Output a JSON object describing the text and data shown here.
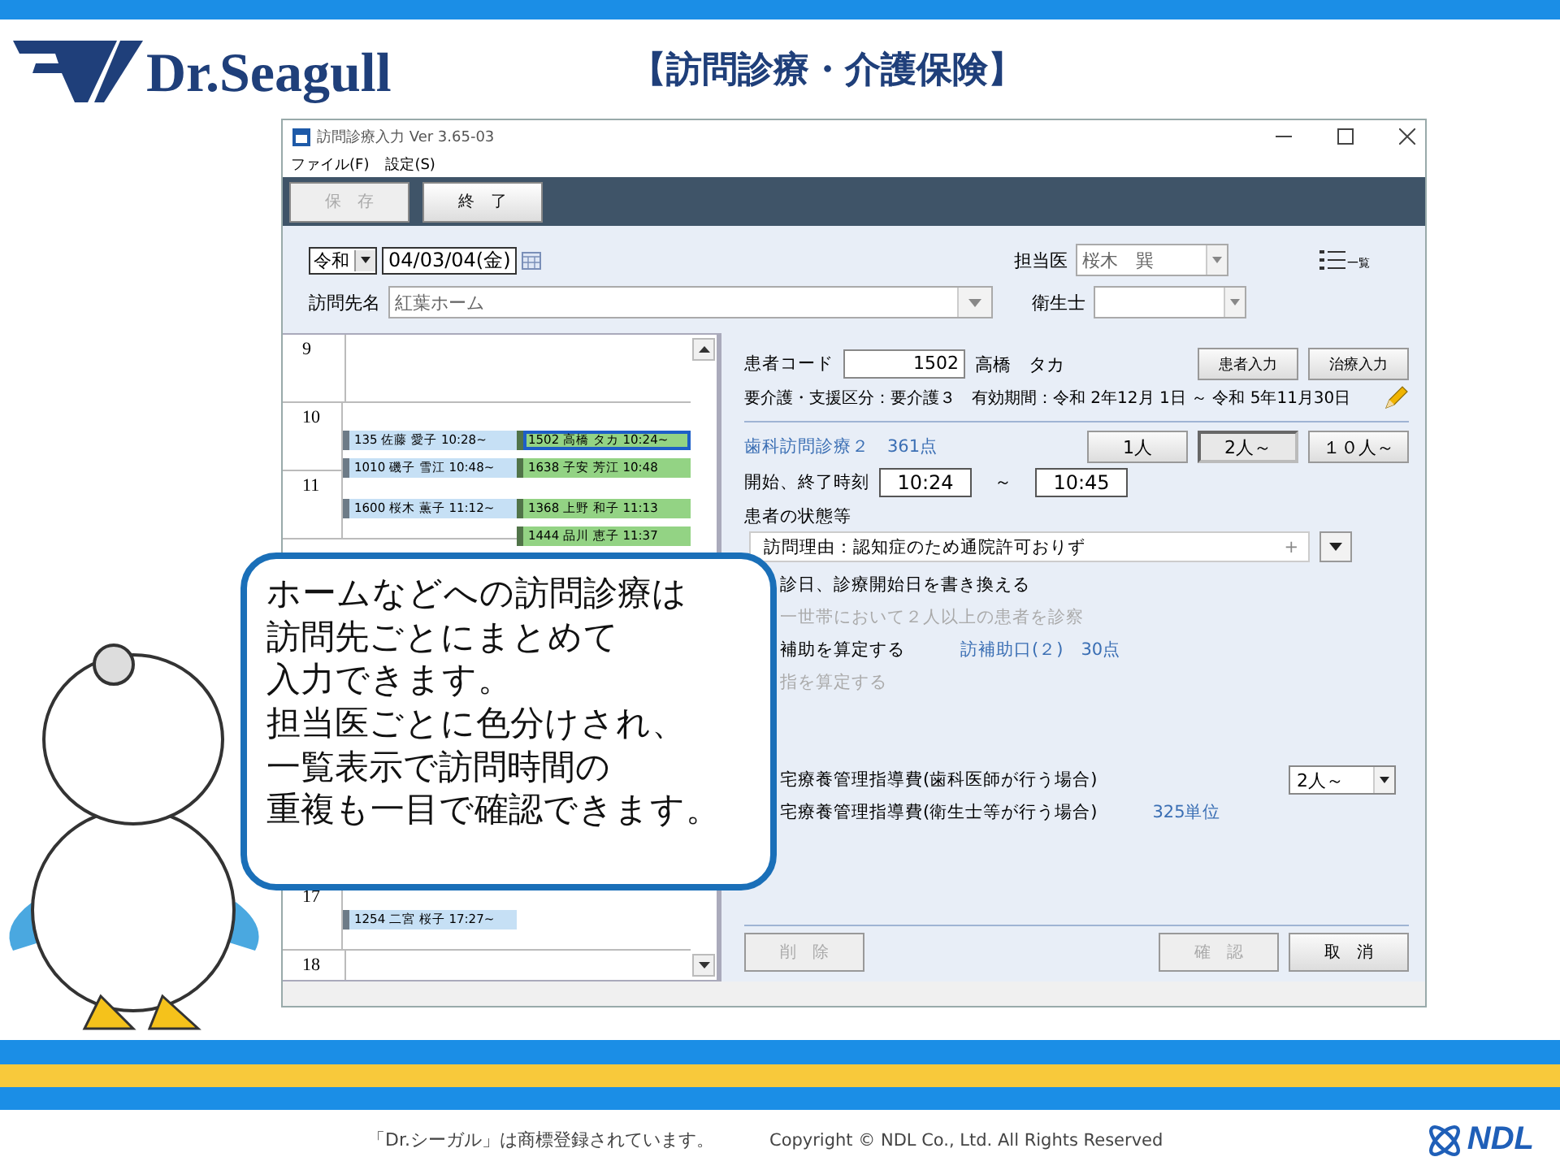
{
  "slide": {
    "logo": "Dr.Seagull",
    "title": "【訪問診療・介護保険】"
  },
  "window": {
    "title": "訪問診療入力 Ver 3.65-03",
    "menu": [
      "ファイル(F)",
      "設定(S)"
    ],
    "toolbar": [
      {
        "label": "保　存",
        "disabled": true
      },
      {
        "label": "終　了",
        "disabled": false
      }
    ],
    "form": {
      "era": "令和",
      "date": "04/03/04(金)",
      "place_label": "訪問先名",
      "place": "紅葉ホーム",
      "doctor_label": "担当医",
      "doctor": "桜木　巽",
      "hygienist_label": "衛生士",
      "list_button": "一覧"
    },
    "calendar": {
      "hours": [
        {
          "hour": "9"
        },
        {
          "hour": "10",
          "slots": [
            {
              "left": {
                "label": "135 佐藤 愛子 10:28~",
                "color": "#c6e0f5",
                "selected": false
              },
              "right": {
                "label": "1502 高橋 タカ 10:24~",
                "color": "#93d384",
                "selected": true
              }
            },
            {
              "left": {
                "label": "1010 磯子 雪江 10:48~",
                "color": "#c6e0f5",
                "selected": false
              },
              "right": {
                "label": "1638 子安 芳江 10:48",
                "color": "#93d384",
                "selected": false
              }
            }
          ]
        },
        {
          "hour": "11",
          "slots": [
            {
              "left": {
                "label": "1600 桜木 薫子 11:12~",
                "color": "#c6e0f5",
                "selected": false
              },
              "right": {
                "label": "1368 上野 和子 11:13",
                "color": "#93d384",
                "selected": false
              }
            },
            {
              "right": {
                "label": "1444 品川 恵子 11:37",
                "color": "#93d384",
                "selected": false
              }
            }
          ]
        },
        {
          "hour": "17",
          "slots": [
            {
              "left": {
                "label": "1254 二宮 桜子 17:27~",
                "color": "#c6e0f5",
                "selected": false
              }
            }
          ]
        },
        {
          "hour": "18"
        }
      ]
    },
    "detail": {
      "code_label": "患者コード",
      "code": "1502",
      "patient": "高橋　タカ",
      "buttons": [
        "患者入力",
        "治療入力"
      ],
      "care": "要介護・支援区分：要介護３　有効期間：令和 2年12月 1日 ～ 令和 5年11月30日",
      "visit": "歯科訪問診療２　361点",
      "people": [
        {
          "label": "1人",
          "selected": false
        },
        {
          "label": "2人～",
          "selected": true
        },
        {
          "label": "１０人～",
          "selected": false
        }
      ],
      "time_label": "開始、終了時刻",
      "start": "10:24",
      "tilde": "～",
      "end": "10:45",
      "state_label": "患者の状態等",
      "state": "訪問理由：認知症のため通院許可おりず",
      "plus": "+",
      "options": [
        {
          "text": "診日、診療開始日を書き換える",
          "disabled": false
        },
        {
          "text": "一世帯において２人以上の患者を診察",
          "disabled": true
        },
        {
          "text": "補助を算定する",
          "disabled": false,
          "note": "訪補助口(２)　30点"
        },
        {
          "text": "指を算定する",
          "disabled": true
        },
        {
          "text": "宅療養管理指導費(歯科医師が行う場合)",
          "disabled": false,
          "select": "2人～"
        },
        {
          "text": "宅療養管理指導費(衛生士等が行う場合)",
          "disabled": false,
          "note": "325単位"
        }
      ],
      "bottom_buttons": [
        {
          "label": "削　除",
          "disabled": true
        },
        {
          "label": "確　認",
          "disabled": true
        },
        {
          "label": "取　消",
          "disabled": false
        }
      ]
    }
  },
  "bubble": {
    "lines": [
      "ホームなどへの訪問診療は",
      "訪問先ごとにまとめて",
      "入力できます。",
      "担当医ごとに色分けされ、",
      "一覧表示で訪問時間の",
      "重複も一目で確認できます。"
    ]
  },
  "footer": {
    "trademark": "「Dr.シーガル」は商標登録されています。",
    "copyright": "Copyright © NDL Co., Ltd. All Rights Reserved",
    "brand": "NDL"
  }
}
